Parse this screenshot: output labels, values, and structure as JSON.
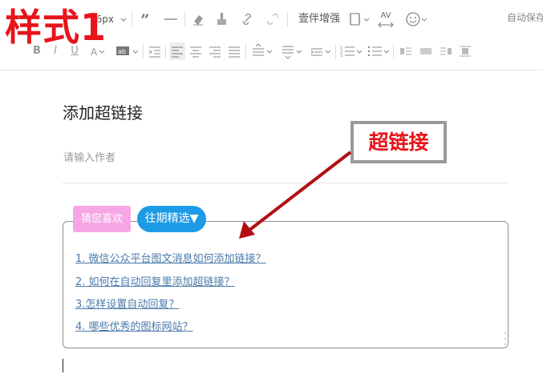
{
  "overlay": {
    "style_label": "样式1",
    "callout_label": "超链接"
  },
  "toolbar": {
    "font_size_label": "16px",
    "decorate_label": "壹伴增强",
    "spacing_label": "AV",
    "autosave_label": "自动保存"
  },
  "editor": {
    "title": "添加超链接",
    "author_placeholder": "请输入作者",
    "tags": {
      "guess_label": "猜您喜欢",
      "past_label": "往期精选▼"
    },
    "links": [
      "1. 微信公众平台图文消息如何添加链接？",
      "2. 如何在自动回复里添加超链接？",
      "3.怎样设置自动回复？",
      "4. 哪些优秀的图标网站？"
    ]
  },
  "colors": {
    "accent_red": "#e8141a",
    "pink_tag": "#f6a6e5",
    "blue_tag": "#1e9be6",
    "link": "#4a79a9"
  }
}
